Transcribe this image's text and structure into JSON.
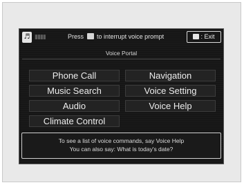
{
  "status_bar": {
    "mic_icon": "microphone-icon",
    "signal_icon": "signal-strength-icon",
    "prompt_before": "Press",
    "prompt_icon": "talk-button-icon",
    "prompt_after": "to interrupt voice prompt",
    "exit_icon": "back-icon",
    "exit_label": ": Exit"
  },
  "title": "Voice Portal",
  "options": {
    "phone_call": "Phone Call",
    "navigation": "Navigation",
    "music_search": "Music Search",
    "voice_setting": "Voice Setting",
    "audio": "Audio",
    "voice_help": "Voice Help",
    "climate_control": "Climate Control"
  },
  "hint": {
    "line1": "To see a list of voice commands, say Voice Help",
    "line2": "You can also say: What is today's date?"
  },
  "colors": {
    "screen_background": "#161616",
    "button_background": "#232323",
    "text": "#ededed",
    "frame": "#e9e9e9"
  }
}
